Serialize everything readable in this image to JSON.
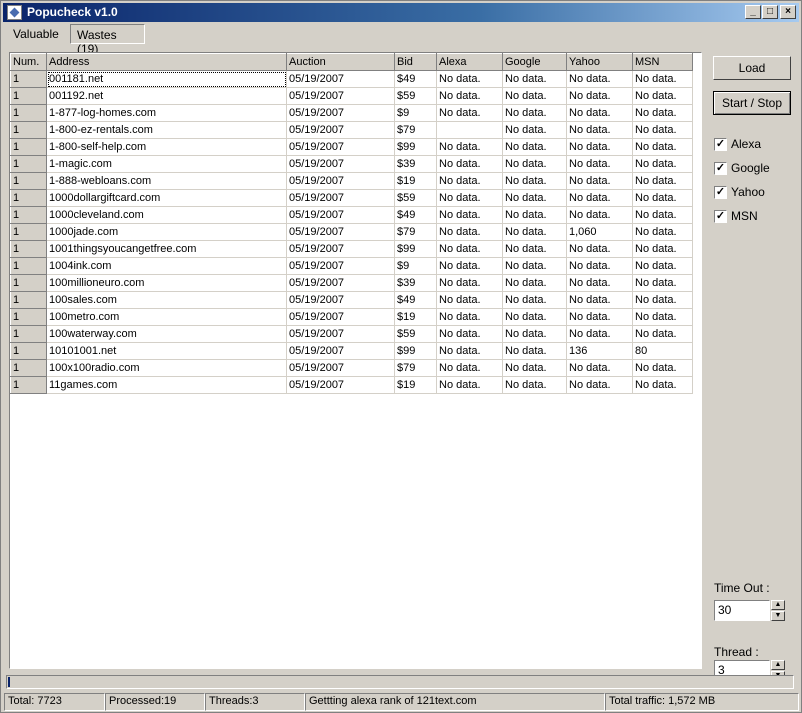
{
  "window": {
    "title": "Popucheck v1.0",
    "minimize": "_",
    "maximize": "□",
    "close": "×"
  },
  "tabs": {
    "valuable": "Valuable",
    "wastes": "Wastes (19)"
  },
  "table": {
    "columns": [
      "Num.",
      "Address",
      "Auction",
      "Bid",
      "Alexa",
      "Google",
      "Yahoo",
      "MSN"
    ],
    "rows": [
      [
        "1",
        "001181.net",
        "05/19/2007",
        "$49",
        "No data.",
        "No data.",
        "No data.",
        "No data."
      ],
      [
        "1",
        "001192.net",
        "05/19/2007",
        "$59",
        "No data.",
        "No data.",
        "No data.",
        "No data."
      ],
      [
        "1",
        "1-877-log-homes.com",
        "05/19/2007",
        "$9",
        "No data.",
        "No data.",
        "No data.",
        "No data."
      ],
      [
        "1",
        "1-800-ez-rentals.com",
        "05/19/2007",
        "$79",
        "",
        "No data.",
        "No data.",
        "No data."
      ],
      [
        "1",
        "1-800-self-help.com",
        "05/19/2007",
        "$99",
        "No data.",
        "No data.",
        "No data.",
        "No data."
      ],
      [
        "1",
        "1-magic.com",
        "05/19/2007",
        "$39",
        "No data.",
        "No data.",
        "No data.",
        "No data."
      ],
      [
        "1",
        "1-888-webloans.com",
        "05/19/2007",
        "$19",
        "No data.",
        "No data.",
        "No data.",
        "No data."
      ],
      [
        "1",
        "1000dollargiftcard.com",
        "05/19/2007",
        "$59",
        "No data.",
        "No data.",
        "No data.",
        "No data."
      ],
      [
        "1",
        "1000cleveland.com",
        "05/19/2007",
        "$49",
        "No data.",
        "No data.",
        "No data.",
        "No data."
      ],
      [
        "1",
        "1000jade.com",
        "05/19/2007",
        "$79",
        "No data.",
        "No data.",
        "1,060",
        "No data."
      ],
      [
        "1",
        "1001thingsyoucangetfree.com",
        "05/19/2007",
        "$99",
        "No data.",
        "No data.",
        "No data.",
        "No data."
      ],
      [
        "1",
        "1004ink.com",
        "05/19/2007",
        "$9",
        "No data.",
        "No data.",
        "No data.",
        "No data."
      ],
      [
        "1",
        "100millioneuro.com",
        "05/19/2007",
        "$39",
        "No data.",
        "No data.",
        "No data.",
        "No data."
      ],
      [
        "1",
        "100sales.com",
        "05/19/2007",
        "$49",
        "No data.",
        "No data.",
        "No data.",
        "No data."
      ],
      [
        "1",
        "100metro.com",
        "05/19/2007",
        "$19",
        "No data.",
        "No data.",
        "No data.",
        "No data."
      ],
      [
        "1",
        "100waterway.com",
        "05/19/2007",
        "$59",
        "No data.",
        "No data.",
        "No data.",
        "No data."
      ],
      [
        "1",
        "10101001.net",
        "05/19/2007",
        "$99",
        "No data.",
        "No data.",
        "136",
        "80"
      ],
      [
        "1",
        "100x100radio.com",
        "05/19/2007",
        "$79",
        "No data.",
        "No data.",
        "No data.",
        "No data."
      ],
      [
        "1",
        "11games.com",
        "05/19/2007",
        "$19",
        "No data.",
        "No data.",
        "No data.",
        "No data."
      ]
    ]
  },
  "buttons": {
    "load": "Load",
    "start_stop": "Start / Stop"
  },
  "checks": {
    "alexa": {
      "label": "Alexa",
      "mark": "✓"
    },
    "google": {
      "label": "Google",
      "mark": "✓"
    },
    "yahoo": {
      "label": "Yahoo",
      "mark": "✓"
    },
    "msn": {
      "label": "MSN",
      "mark": "✓"
    }
  },
  "timeout": {
    "label": "Time Out :",
    "value": "30"
  },
  "thread": {
    "label": "Thread :",
    "value": "3"
  },
  "progress": {
    "fraction": 0.003,
    "color": "#0a246a"
  },
  "status": {
    "total": "Total: 7723",
    "processed": "Processed:19",
    "threads": "Threads:3",
    "message": "Gettting alexa rank of 121text.com",
    "traffic": "Total traffic: 1,572 MB"
  }
}
